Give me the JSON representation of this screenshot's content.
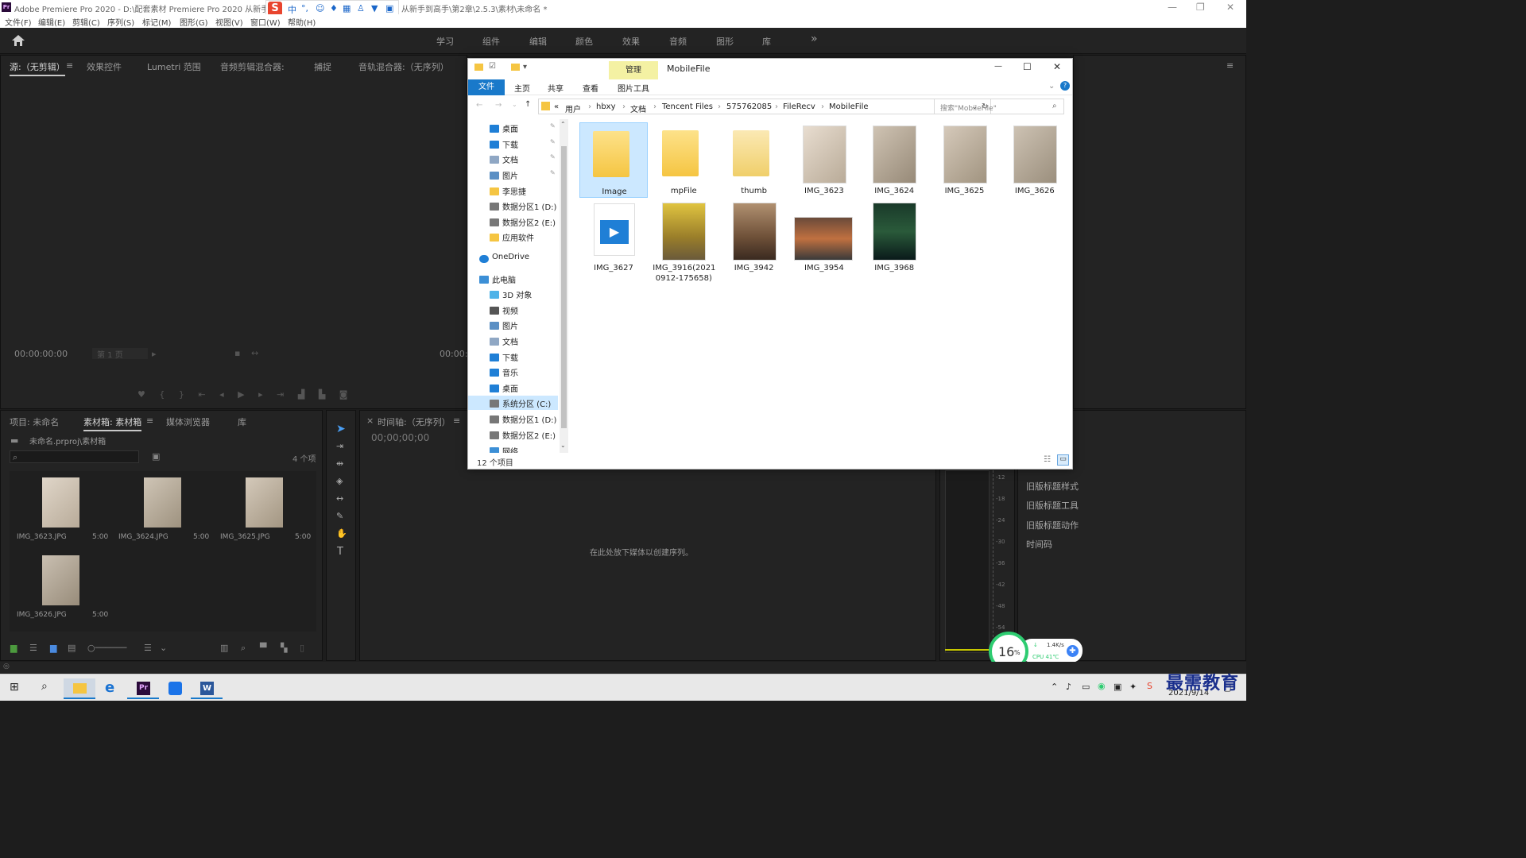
{
  "titlebar": {
    "title": "Adobe Premiere Pro 2020 - D:\\配套素材 Premiere Pro 2020 从新手",
    "title_tail": "从新手到高手\\第2章\\2.5.3\\素材\\未命名 *"
  },
  "ime": {
    "logo": "S",
    "items": [
      "中",
      "°,"
    ]
  },
  "menu": [
    "文件(F)",
    "编辑(E)",
    "剪辑(C)",
    "序列(S)",
    "标记(M)",
    "图形(G)",
    "视图(V)",
    "窗口(W)",
    "帮助(H)"
  ],
  "workspaces": [
    "学习",
    "组件",
    "编辑",
    "颜色",
    "效果",
    "音频",
    "图形",
    "库"
  ],
  "workspace_more": "»",
  "source_panel": {
    "tabs": [
      "源:（无剪辑）",
      "效果控件",
      "Lumetri 范围",
      "音频剪辑混合器:",
      "捕捉",
      "音轨混合器:（无序列）"
    ],
    "timecode_left": "00:00:00:00",
    "page_select": "第 1 页",
    "timecode_right": "00:00:"
  },
  "project_panel": {
    "tabs": [
      "项目: 未命名",
      "素材箱: 素材箱",
      "媒体浏览器",
      "库"
    ],
    "path": "未命名.prproj\\素材箱",
    "item_count": "4 个项",
    "clips": [
      {
        "name": "IMG_3623.JPG",
        "duration": "5:00"
      },
      {
        "name": "IMG_3624.JPG",
        "duration": "5:00"
      },
      {
        "name": "IMG_3625.JPG",
        "duration": "5:00"
      },
      {
        "name": "IMG_3626.JPG",
        "duration": "5:00"
      }
    ]
  },
  "timeline_panel": {
    "tab": "时间轴:（无序列）",
    "timecode": "00;00;00;00",
    "drop_hint": "在此处放下媒体以创建序列。"
  },
  "meter_scale": [
    "-12",
    "-18",
    "-24",
    "-30",
    "-36",
    "-42",
    "-48",
    "-54"
  ],
  "right_panel_items": [
    "旧版标题样式",
    "旧版标题工具",
    "旧版标题动作",
    "时间码"
  ],
  "explorer": {
    "window_title": "MobileFile",
    "manage_tab": "管理",
    "ribbon_tabs": [
      "文件",
      "主页",
      "共享",
      "查看"
    ],
    "picture_tools": "图片工具",
    "address": [
      "«",
      "用户",
      "hbxy",
      "文档",
      "Tencent Files",
      "575762085",
      "FileRecv",
      "MobileFile"
    ],
    "search_placeholder": "搜索\"MobileFile\"",
    "nav": [
      {
        "label": "桌面",
        "icon": "desktop-icon",
        "pinned": true
      },
      {
        "label": "下载",
        "icon": "download-icon",
        "pinned": true
      },
      {
        "label": "文档",
        "icon": "document-icon",
        "pinned": true
      },
      {
        "label": "图片",
        "icon": "picture-icon",
        "pinned": true
      },
      {
        "label": "李思捷",
        "icon": "folder-icon",
        "pinned": false
      },
      {
        "label": "数据分区1 (D:)",
        "icon": "drive-icon",
        "pinned": false
      },
      {
        "label": "数据分区2 (E:)",
        "icon": "drive-icon",
        "pinned": false
      },
      {
        "label": "应用软件",
        "icon": "folder-icon",
        "pinned": false
      },
      {
        "label": "OneDrive",
        "icon": "cloud-icon",
        "pinned": false
      },
      {
        "label": "此电脑",
        "icon": "computer-icon",
        "pinned": false
      },
      {
        "label": "3D 对象",
        "icon": "3d-icon",
        "pinned": false
      },
      {
        "label": "视频",
        "icon": "video-icon",
        "pinned": false
      },
      {
        "label": "图片",
        "icon": "picture-icon",
        "pinned": false
      },
      {
        "label": "文档",
        "icon": "document-icon",
        "pinned": false
      },
      {
        "label": "下载",
        "icon": "download-icon",
        "pinned": false
      },
      {
        "label": "音乐",
        "icon": "music-icon",
        "pinned": false
      },
      {
        "label": "桌面",
        "icon": "desktop-icon",
        "pinned": false
      },
      {
        "label": "系统分区 (C:)",
        "icon": "drive-icon",
        "pinned": false
      },
      {
        "label": "数据分区1 (D:)",
        "icon": "drive-icon",
        "pinned": false
      },
      {
        "label": "数据分区2 (E:)",
        "icon": "drive-icon",
        "pinned": false
      },
      {
        "label": "网络",
        "icon": "network-icon",
        "pinned": false
      }
    ],
    "items": [
      {
        "name": "Image",
        "type": "folder"
      },
      {
        "name": "mpFile",
        "type": "folder"
      },
      {
        "name": "thumb",
        "type": "folder"
      },
      {
        "name": "IMG_3623",
        "type": "image"
      },
      {
        "name": "IMG_3624",
        "type": "image"
      },
      {
        "name": "IMG_3625",
        "type": "image"
      },
      {
        "name": "IMG_3626",
        "type": "image"
      },
      {
        "name": "IMG_3627",
        "type": "video"
      },
      {
        "name": "IMG_3916(2021 0912-175658)",
        "type": "image"
      },
      {
        "name": "IMG_3942",
        "type": "image"
      },
      {
        "name": "IMG_3954",
        "type": "image"
      },
      {
        "name": "IMG_3968",
        "type": "image"
      }
    ],
    "status": "12 个项目"
  },
  "perf_widget": {
    "percent": "16",
    "percent_sign": "%",
    "speed": "1.4K/s",
    "cpu": "CPU 41℃"
  },
  "taskbar": {
    "date": "2021/9/14",
    "watermark": "最需教育"
  },
  "colors": {
    "accent_blue": "#1979ca",
    "premiere_bg": "#232323",
    "manage_yellow": "#f4f1a3",
    "perf_green": "#2ecc71"
  }
}
